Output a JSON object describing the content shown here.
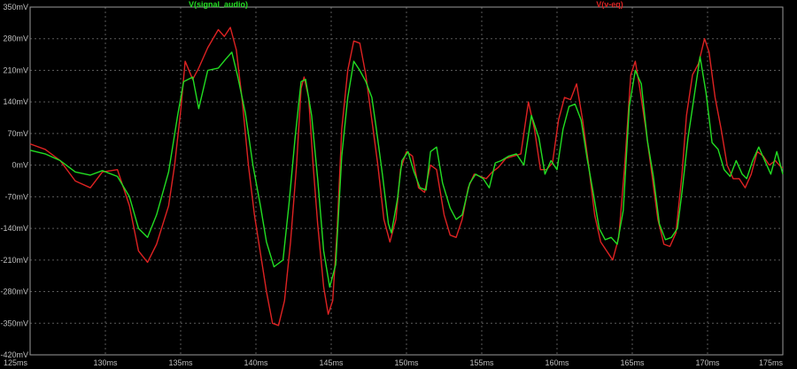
{
  "chart_data": {
    "type": "line",
    "x_unit": "ms",
    "xlim": [
      125,
      175
    ],
    "ylim": [
      -420,
      350
    ],
    "grid": true,
    "y_ticks": [
      {
        "v": 350,
        "label": "350mV"
      },
      {
        "v": 280,
        "label": "280mV"
      },
      {
        "v": 210,
        "label": "210mV"
      },
      {
        "v": 140,
        "label": "140mV"
      },
      {
        "v": 70,
        "label": "70mV"
      },
      {
        "v": 0,
        "label": "0mV"
      },
      {
        "v": -70,
        "label": "-70mV"
      },
      {
        "v": -140,
        "label": "-140mV"
      },
      {
        "v": -210,
        "label": "-210mV"
      },
      {
        "v": -280,
        "label": "-280mV"
      },
      {
        "v": -350,
        "label": "-350mV"
      },
      {
        "v": -420,
        "label": "-420mV"
      }
    ],
    "x_ticks": [
      {
        "v": 125,
        "label": "125ms"
      },
      {
        "v": 130,
        "label": "130ms"
      },
      {
        "v": 135,
        "label": "135ms"
      },
      {
        "v": 140,
        "label": "140ms"
      },
      {
        "v": 145,
        "label": "145ms"
      },
      {
        "v": 150,
        "label": "150ms"
      },
      {
        "v": 155,
        "label": "155ms"
      },
      {
        "v": 160,
        "label": "160ms"
      },
      {
        "v": 165,
        "label": "165ms"
      },
      {
        "v": 170,
        "label": "170ms"
      },
      {
        "v": 175,
        "label": "175ms"
      }
    ],
    "series": [
      {
        "name": "V(signal_audio)",
        "color": "#22dd22",
        "points": [
          [
            125,
            33
          ],
          [
            126,
            25
          ],
          [
            127,
            10
          ],
          [
            128,
            -15
          ],
          [
            129,
            -22
          ],
          [
            129.8,
            -12
          ],
          [
            130.8,
            -25
          ],
          [
            131.6,
            -70
          ],
          [
            132.2,
            -140
          ],
          [
            132.8,
            -160
          ],
          [
            133.4,
            -110
          ],
          [
            134.2,
            -15
          ],
          [
            134.8,
            110
          ],
          [
            135.2,
            185
          ],
          [
            135.8,
            195
          ],
          [
            136.2,
            125
          ],
          [
            136.8,
            210
          ],
          [
            137.5,
            215
          ],
          [
            138.0,
            235
          ],
          [
            138.4,
            250
          ],
          [
            138.8,
            195
          ],
          [
            139.3,
            115
          ],
          [
            139.8,
            0
          ],
          [
            140.3,
            -90
          ],
          [
            140.7,
            -170
          ],
          [
            141.2,
            -225
          ],
          [
            141.8,
            -210
          ],
          [
            142.2,
            -85
          ],
          [
            142.6,
            60
          ],
          [
            143.0,
            185
          ],
          [
            143.3,
            190
          ],
          [
            143.7,
            110
          ],
          [
            144.1,
            -30
          ],
          [
            144.5,
            -190
          ],
          [
            144.9,
            -270
          ],
          [
            145.3,
            -220
          ],
          [
            145.7,
            20
          ],
          [
            146.1,
            150
          ],
          [
            146.5,
            230
          ],
          [
            146.9,
            210
          ],
          [
            147.3,
            185
          ],
          [
            147.7,
            150
          ],
          [
            148.0,
            80
          ],
          [
            148.4,
            -20
          ],
          [
            148.8,
            -130
          ],
          [
            149.0,
            -150
          ],
          [
            149.4,
            -75
          ],
          [
            149.7,
            10
          ],
          [
            150.1,
            30
          ],
          [
            150.5,
            -15
          ],
          [
            150.9,
            -50
          ],
          [
            151.3,
            -55
          ],
          [
            151.6,
            30
          ],
          [
            152.0,
            40
          ],
          [
            152.4,
            -40
          ],
          [
            152.9,
            -95
          ],
          [
            153.3,
            -120
          ],
          [
            153.7,
            -110
          ],
          [
            154.2,
            -40
          ],
          [
            154.6,
            -20
          ],
          [
            155.1,
            -30
          ],
          [
            155.5,
            -50
          ],
          [
            155.9,
            5
          ],
          [
            156.3,
            10
          ],
          [
            156.8,
            20
          ],
          [
            157.3,
            25
          ],
          [
            157.8,
            0
          ],
          [
            158.3,
            110
          ],
          [
            158.8,
            60
          ],
          [
            159.2,
            -20
          ],
          [
            159.6,
            10
          ],
          [
            160.0,
            -10
          ],
          [
            160.4,
            80
          ],
          [
            160.8,
            130
          ],
          [
            161.2,
            135
          ],
          [
            161.6,
            100
          ],
          [
            162.0,
            15
          ],
          [
            162.4,
            -60
          ],
          [
            162.8,
            -140
          ],
          [
            163.2,
            -165
          ],
          [
            163.6,
            -160
          ],
          [
            164.0,
            -175
          ],
          [
            164.4,
            -100
          ],
          [
            164.8,
            130
          ],
          [
            165.2,
            210
          ],
          [
            165.6,
            180
          ],
          [
            166.0,
            55
          ],
          [
            166.4,
            -25
          ],
          [
            166.8,
            -130
          ],
          [
            167.2,
            -165
          ],
          [
            167.6,
            -160
          ],
          [
            168.0,
            -140
          ],
          [
            168.3,
            -60
          ],
          [
            168.7,
            60
          ],
          [
            169.1,
            150
          ],
          [
            169.5,
            240
          ],
          [
            169.9,
            160
          ],
          [
            170.3,
            50
          ],
          [
            170.7,
            35
          ],
          [
            171.1,
            -10
          ],
          [
            171.5,
            -25
          ],
          [
            171.9,
            10
          ],
          [
            172.3,
            -20
          ],
          [
            172.6,
            -30
          ],
          [
            173.0,
            10
          ],
          [
            173.4,
            40
          ],
          [
            173.8,
            10
          ],
          [
            174.2,
            -20
          ],
          [
            174.6,
            30
          ],
          [
            175,
            -20
          ]
        ]
      },
      {
        "name": "V(v-eq)",
        "color": "#dd2222",
        "points": [
          [
            125,
            47
          ],
          [
            126,
            35
          ],
          [
            127,
            10
          ],
          [
            128,
            -35
          ],
          [
            129,
            -50
          ],
          [
            129.8,
            -15
          ],
          [
            130.8,
            -10
          ],
          [
            131.6,
            -90
          ],
          [
            132.2,
            -190
          ],
          [
            132.8,
            -215
          ],
          [
            133.4,
            -175
          ],
          [
            134.2,
            -90
          ],
          [
            134.6,
            0
          ],
          [
            135.0,
            120
          ],
          [
            135.3,
            230
          ],
          [
            135.8,
            190
          ],
          [
            136.2,
            215
          ],
          [
            136.8,
            260
          ],
          [
            137.5,
            300
          ],
          [
            137.9,
            285
          ],
          [
            138.3,
            305
          ],
          [
            138.7,
            255
          ],
          [
            139.1,
            140
          ],
          [
            139.5,
            0
          ],
          [
            139.9,
            -110
          ],
          [
            140.3,
            -195
          ],
          [
            140.7,
            -280
          ],
          [
            141.1,
            -350
          ],
          [
            141.5,
            -355
          ],
          [
            141.9,
            -300
          ],
          [
            142.3,
            -170
          ],
          [
            142.7,
            0
          ],
          [
            143.0,
            170
          ],
          [
            143.2,
            195
          ],
          [
            143.5,
            150
          ],
          [
            143.8,
            0
          ],
          [
            144.1,
            -130
          ],
          [
            144.5,
            -270
          ],
          [
            144.8,
            -330
          ],
          [
            145.1,
            -300
          ],
          [
            145.4,
            -140
          ],
          [
            145.7,
            80
          ],
          [
            146.1,
            210
          ],
          [
            146.5,
            275
          ],
          [
            146.9,
            270
          ],
          [
            147.3,
            200
          ],
          [
            147.7,
            100
          ],
          [
            148.1,
            0
          ],
          [
            148.5,
            -120
          ],
          [
            148.9,
            -170
          ],
          [
            149.3,
            -120
          ],
          [
            149.6,
            -10
          ],
          [
            150.0,
            30
          ],
          [
            150.4,
            20
          ],
          [
            150.8,
            -50
          ],
          [
            151.2,
            -60
          ],
          [
            151.6,
            0
          ],
          [
            152.0,
            -10
          ],
          [
            152.5,
            -110
          ],
          [
            152.9,
            -155
          ],
          [
            153.3,
            -160
          ],
          [
            153.7,
            -120
          ],
          [
            154.1,
            -50
          ],
          [
            154.5,
            -20
          ],
          [
            154.9,
            -25
          ],
          [
            155.3,
            -30
          ],
          [
            155.7,
            -15
          ],
          [
            156.1,
            -5
          ],
          [
            156.6,
            15
          ],
          [
            157.1,
            20
          ],
          [
            157.6,
            25
          ],
          [
            158.1,
            140
          ],
          [
            158.5,
            80
          ],
          [
            158.9,
            -10
          ],
          [
            159.3,
            -10
          ],
          [
            159.7,
            5
          ],
          [
            160.1,
            100
          ],
          [
            160.5,
            150
          ],
          [
            160.9,
            145
          ],
          [
            161.3,
            180
          ],
          [
            161.7,
            100
          ],
          [
            162.1,
            0
          ],
          [
            162.5,
            -110
          ],
          [
            162.9,
            -170
          ],
          [
            163.3,
            -190
          ],
          [
            163.7,
            -210
          ],
          [
            164.1,
            -160
          ],
          [
            164.5,
            0
          ],
          [
            164.9,
            200
          ],
          [
            165.2,
            230
          ],
          [
            165.5,
            170
          ],
          [
            165.9,
            80
          ],
          [
            166.3,
            -20
          ],
          [
            166.7,
            -120
          ],
          [
            167.1,
            -175
          ],
          [
            167.5,
            -180
          ],
          [
            167.9,
            -150
          ],
          [
            168.3,
            -20
          ],
          [
            168.6,
            110
          ],
          [
            169.0,
            200
          ],
          [
            169.4,
            225
          ],
          [
            169.8,
            280
          ],
          [
            170.1,
            250
          ],
          [
            170.5,
            150
          ],
          [
            170.9,
            80
          ],
          [
            171.3,
            0
          ],
          [
            171.7,
            -30
          ],
          [
            172.1,
            -30
          ],
          [
            172.5,
            -50
          ],
          [
            172.9,
            -20
          ],
          [
            173.3,
            30
          ],
          [
            173.7,
            20
          ],
          [
            174.1,
            0
          ],
          [
            174.5,
            10
          ],
          [
            174.9,
            -5
          ],
          [
            175,
            -5
          ]
        ]
      }
    ]
  }
}
